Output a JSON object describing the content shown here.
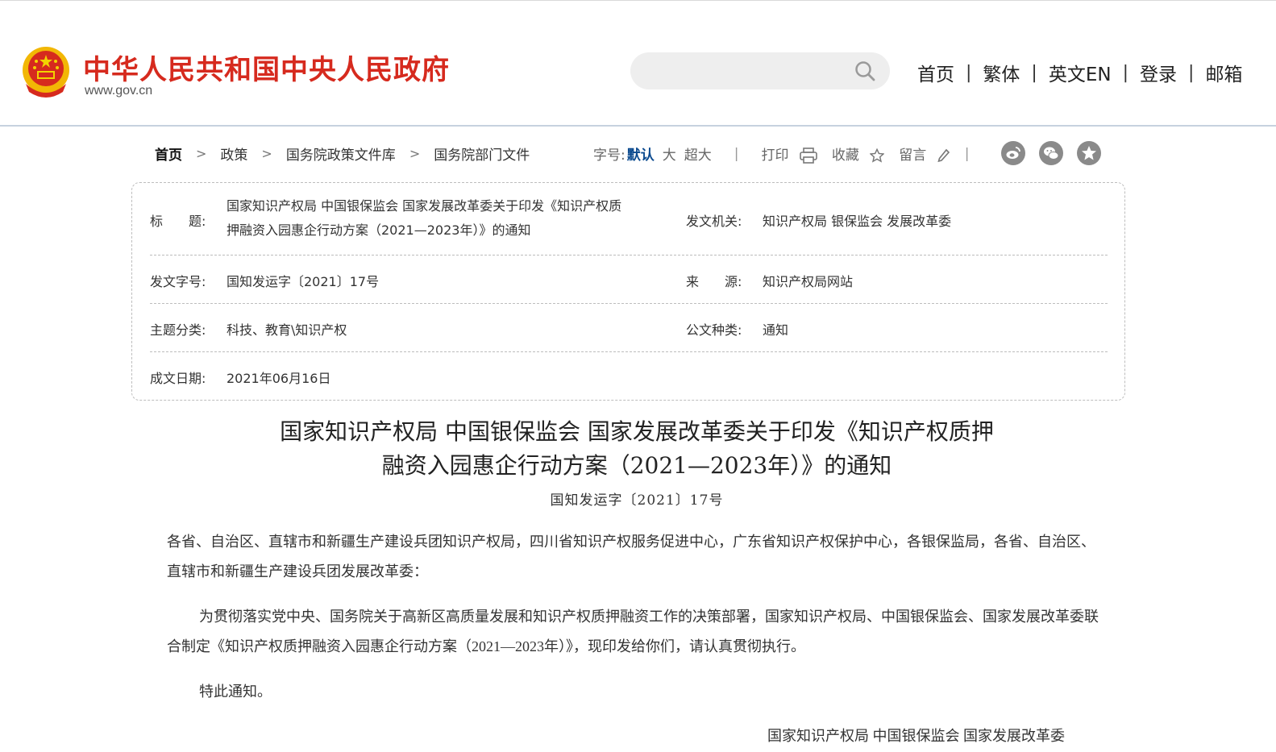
{
  "header": {
    "site_title": "中华人民共和国中央人民政府",
    "site_domain": "www.gov.cn",
    "search_placeholder": "",
    "nav": [
      "首页",
      "繁体",
      "英文EN",
      "登录",
      "邮箱"
    ],
    "nav_separator": "|",
    "brand_color": "#d62a1e"
  },
  "breadcrumb": {
    "items": [
      "首页",
      "政策",
      "国务院政策文件库",
      "国务院部门文件"
    ],
    "arrow": ">"
  },
  "tools": {
    "font_label": "字号:",
    "font_default": "默认",
    "font_large": "大",
    "font_xlarge": "超大",
    "print": "打印",
    "favorite": "收藏",
    "comment": "留言",
    "separator": "|",
    "share_icons": [
      "weibo-icon",
      "wechat-icon",
      "qzone-icon"
    ]
  },
  "info": {
    "title_label": "标　　题:",
    "title_line1": "国家知识产权局 中国银保监会 国家发展改革委关于印发《知识产权质",
    "title_line2": "押融资入园惠企行动方案（2021—2023年）》的通知",
    "issuer_label": "发文机关:",
    "issuer_value": "知识产权局 银保监会 发展改革委",
    "doc_no_label": "发文字号:",
    "doc_no_value": "国知发运字〔2021〕17号",
    "source_label": "来　　源:",
    "source_value": "知识产权局网站",
    "topic_label": "主题分类:",
    "topic_value": "科技、教育\\知识产权",
    "type_label": "公文种类:",
    "type_value": "通知",
    "date_label": "成文日期:",
    "date_value": "2021年06月16日"
  },
  "article": {
    "title_line1": "国家知识产权局 中国银保监会 国家发展改革委关于印发《知识产权质押",
    "title_line2": "融资入园惠企行动方案（2021—2023年）》的通知",
    "doc_number": "国知发运字〔2021〕17号",
    "salutation": "各省、自治区、直辖市和新疆生产建设兵团知识产权局，四川省知识产权服务促进中心，广东省知识产权保护中心，各银保监局，各省、自治区、直辖市和新疆生产建设兵团发展改革委：",
    "body": "为贯彻落实党中央、国务院关于高新区高质量发展和知识产权质押融资工作的决策部署，国家知识产权局、中国银保监会、国家发展改革委联合制定《知识产权质押融资入园惠企行动方案（2021—2023年）》，现印发给你们，请认真贯彻执行。",
    "closing": "特此通知。",
    "signature": "国家知识产权局 中国银保监会 国家发展改革委"
  }
}
